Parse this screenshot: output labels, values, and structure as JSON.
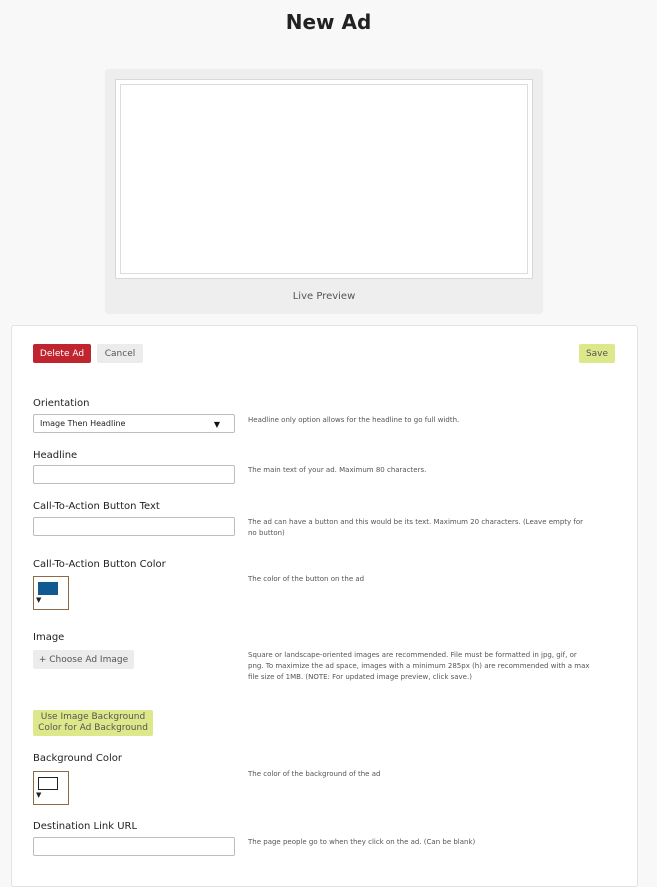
{
  "page": {
    "title": "New Ad"
  },
  "preview": {
    "label": "Live Preview"
  },
  "toolbar": {
    "delete_label": "Delete Ad",
    "cancel_label": "Cancel",
    "save_label": "Save"
  },
  "fields": {
    "orientation": {
      "label": "Orientation",
      "value": "Image Then Headline",
      "help": "Headline only option allows for the headline to go full width."
    },
    "headline": {
      "label": "Headline",
      "value": "",
      "help": "The main text of your ad. Maximum 80 characters."
    },
    "cta_text": {
      "label": "Call-To-Action Button Text",
      "value": "",
      "help": "The ad can have a button and this would be its text. Maximum 20 characters. (Leave empty for no button)"
    },
    "cta_color": {
      "label": "Call-To-Action Button Color",
      "color": "#0e5a91",
      "help": "The color of the button on the ad"
    },
    "image": {
      "label": "Image",
      "button_label": "+ Choose Ad Image",
      "help": "Square or landscape-oriented images are recommended. File must be formatted in jpg, gif, or png. To maximize the ad space, images with a minimum 285px (h) are recommended with a max file size of 1MB. (NOTE: For updated image preview, click save.)"
    },
    "use_image_bg": {
      "button_label": "Use Image Background Color for Ad Background"
    },
    "bg_color": {
      "label": "Background Color",
      "color": "#ffffff",
      "help": "The color of the background of the ad"
    },
    "destination": {
      "label": "Destination Link URL",
      "value": "",
      "help": "The page people go to when they click on the ad. (Can be blank)"
    }
  },
  "colors": {
    "delete": "#c0252f",
    "save": "#dde88a",
    "neutral_button": "#ececec"
  }
}
